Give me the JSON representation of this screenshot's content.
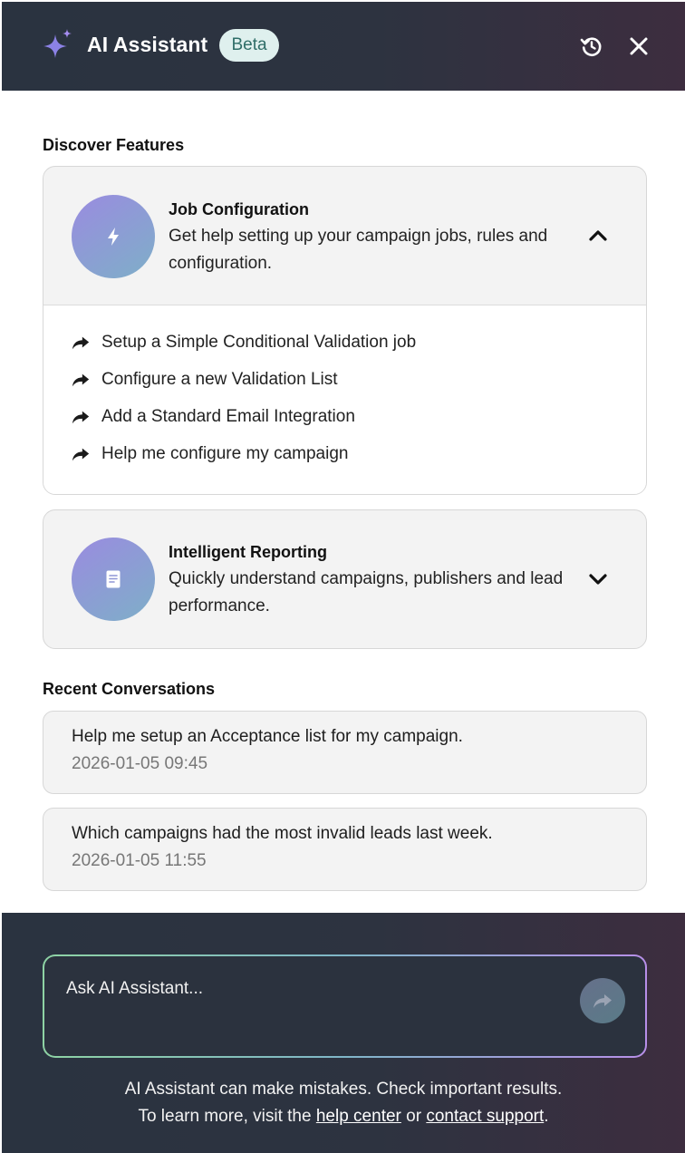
{
  "header": {
    "icon": "sparkle-icon",
    "title": "AI Assistant",
    "badge": "Beta",
    "history_icon": "history-icon",
    "close_icon": "close-icon"
  },
  "discover": {
    "title": "Discover Features",
    "features": [
      {
        "icon": "lightning-icon",
        "title": "Job Configuration",
        "description": "Get help setting up your campaign jobs, rules and configuration.",
        "expanded": true,
        "chevron_icon": "chevron-up-icon",
        "prompts": [
          "Setup a Simple Conditional Validation job",
          "Configure a new Validation List",
          "Add a Standard Email Integration",
          "Help me configure my campaign"
        ]
      },
      {
        "icon": "report-document-icon",
        "title": "Intelligent Reporting",
        "description": "Quickly understand campaigns, publishers and lead performance.",
        "expanded": false,
        "chevron_icon": "chevron-down-icon"
      }
    ]
  },
  "recent": {
    "title": "Recent Conversations",
    "items": [
      {
        "question": "Help me setup an Acceptance list for my campaign.",
        "timestamp": "2026-01-05 09:45"
      },
      {
        "question": "Which campaigns had the most invalid leads last week.",
        "timestamp": "2026-01-05 11:55"
      }
    ]
  },
  "footer": {
    "placeholder": "Ask AI Assistant...",
    "send_icon": "send-arrow-icon",
    "disclaimer_line1": "AI Assistant can make mistakes. Check important results.",
    "disclaimer_line2_prefix": "To learn more, visit the",
    "help_link": "help center",
    "or_text": "or",
    "support_link": "contact support",
    "period": "."
  },
  "colors": {
    "header_bg": "#2d3340",
    "badge_bg": "#dff0ee",
    "badge_text": "#2f6e68",
    "card_bg": "#f3f3f3",
    "icon_circle_start": "#9a8be0",
    "icon_circle_end": "#7eafc8",
    "input_border_start": "#8ed3a4",
    "input_border_end": "#b78fe8"
  }
}
